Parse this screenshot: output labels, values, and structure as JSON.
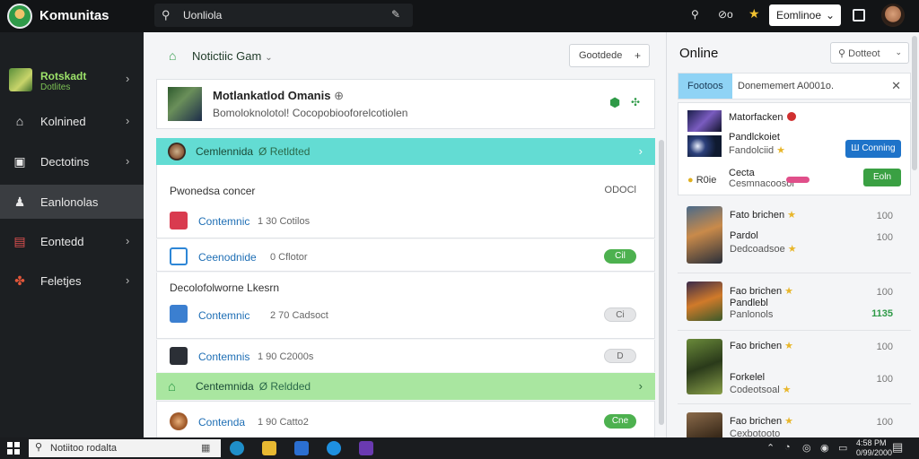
{
  "topbar": {
    "app_name": "Komunitas",
    "search_text": "Uonliola",
    "item_a": "Ω",
    "item_b": "⊘o",
    "button_label": "Eomlinoe"
  },
  "sidebar": {
    "top_title": "Rotskadt",
    "top_sub": "Dotlites",
    "items": [
      {
        "label": "Kolnined"
      },
      {
        "label": "Dectotins"
      },
      {
        "label": "Eanlonolas"
      },
      {
        "label": "Eontedd"
      },
      {
        "label": "Feletjes"
      }
    ]
  },
  "main": {
    "header_title": "Notictiic Gam",
    "header_button": "Gootdede",
    "featured": {
      "title": "Motlankatlod Omanis",
      "subtitle": "Bomoloknolotol! Cocopobiooforelcotiolen"
    },
    "bar1": {
      "title": "Cemlennida",
      "sub": "Ø Retldted"
    },
    "sec1": {
      "header": "Pwonedsa concer",
      "right": "ODOCl"
    },
    "row1": {
      "title": "Contemnic",
      "meta": "1 30 Cotilos"
    },
    "row2": {
      "title": "Ceenodnide",
      "meta": "0 Cflotor",
      "pill": "Cil"
    },
    "sec2": {
      "header": "Decolofolworne Lkesrn"
    },
    "row3": {
      "title": "Contemnic",
      "meta": "2 70 Cadsoct",
      "pill": "Ci"
    },
    "row4": {
      "title": "Contemnis",
      "meta": "1 90 C2000s",
      "pill": "D"
    },
    "bar2": {
      "title": "Centemnida",
      "sub": "Ø Reldded"
    },
    "row5": {
      "title": "Contenda",
      "meta": "1 90 Catto2",
      "pill": "Cne"
    }
  },
  "right": {
    "title": "Online",
    "button": "Dotteot",
    "tab_active": "Footoos",
    "tab_other": "Donememert A0001o.",
    "online": {
      "l1": "Matorfacken",
      "l2": "Pandlckoiet",
      "l3": "Fandolciid",
      "l4": "Cecta",
      "l5": "Cesmnacoosor",
      "blue_btn": "Ш Conning",
      "green_btn": "Eoln",
      "small": "R0ie"
    },
    "games": [
      {
        "t1": "Fato brichen",
        "t2": "Pardol",
        "t3": "Dedcoadsoe",
        "n1": "100",
        "n2": "100"
      },
      {
        "t1": "Fao brichen",
        "t2": "Pandlebl",
        "t3": "Panlonols",
        "n1": "100",
        "n2": "1135"
      },
      {
        "t1": "Fao brichen",
        "t2": "Forkelel",
        "t3": "Codeotsoal",
        "n1": "100",
        "n2": "100"
      },
      {
        "t1": "Fao brichen",
        "t2": "Cexbotooto",
        "n1": "100"
      }
    ]
  },
  "taskbar": {
    "search": "Notiitoo rodalta",
    "clock_time": "4:58 PM",
    "clock_date": "0/99/2000"
  }
}
